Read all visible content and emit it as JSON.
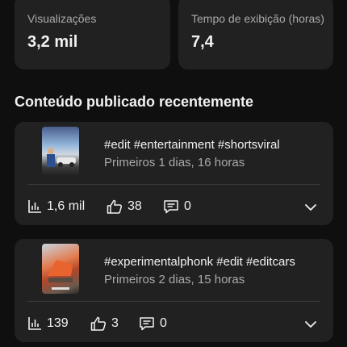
{
  "stats": {
    "views": {
      "label": "Visualizações",
      "value": "3,2 mil"
    },
    "watch_time": {
      "label": "Tempo de exibição (horas)",
      "value": "7,4"
    }
  },
  "section_title": "Conteúdo publicado recentemente",
  "videos": [
    {
      "title": "#edit #entertainment #shortsviral",
      "subtitle": "Primeiros 1 dias, 16 horas",
      "views": "1,6 mil",
      "likes": "38",
      "comments": "0",
      "thumbnail_icon": "car-thumbnail"
    },
    {
      "title": "#experimentalphonk #edit #editcars",
      "subtitle": "Primeiros 2 dias, 15 horas",
      "views": "139",
      "likes": "3",
      "comments": "0",
      "thumbnail_icon": "orange-car-thumbnail"
    }
  ],
  "icons": {
    "views": "bar-chart-icon",
    "likes": "thumbs-up-icon",
    "comments": "comment-icon",
    "expand": "chevron-down-icon"
  },
  "colors": {
    "background": "#0f0f0f",
    "card": "#212121",
    "text_primary": "#f1f1f1",
    "text_secondary": "#aaaaaa"
  }
}
